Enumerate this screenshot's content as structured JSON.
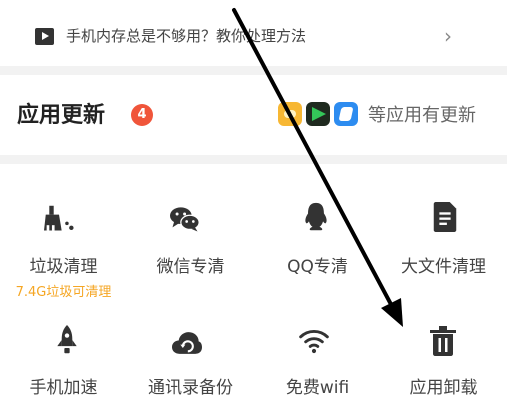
{
  "tip": {
    "text": "手机内存总是不够用？教你处理方法",
    "icon": "play-icon",
    "chevron": "›"
  },
  "updates": {
    "title": "应用更新",
    "badge": "4",
    "more_text": "等应用有更新",
    "app_icons": [
      "app-icon-1",
      "app-icon-2",
      "app-icon-3"
    ]
  },
  "tools": [
    {
      "label": "垃圾清理",
      "sub": "7.4G垃圾可清理",
      "icon": "broom-icon"
    },
    {
      "label": "微信专清",
      "icon": "wechat-icon"
    },
    {
      "label": "QQ专清",
      "icon": "qq-icon"
    },
    {
      "label": "大文件清理",
      "icon": "document-icon"
    },
    {
      "label": "手机加速",
      "icon": "rocket-icon"
    },
    {
      "label": "通讯录备份",
      "icon": "cloud-icon"
    },
    {
      "label": "免费wifi",
      "icon": "wifi-icon"
    },
    {
      "label": "应用卸载",
      "icon": "trash-icon"
    }
  ],
  "colors": {
    "badge": "#f0553a",
    "sub_text": "#f5a623",
    "icon": "#333333",
    "divider": "#f2f2f2"
  }
}
